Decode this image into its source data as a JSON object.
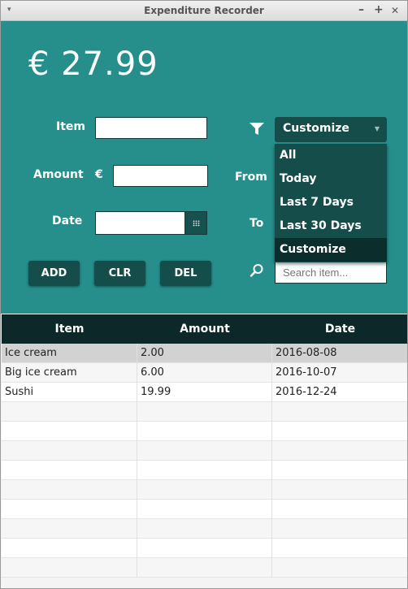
{
  "window": {
    "title": "Expenditure Recorder",
    "menu_glyph": "▾",
    "controls": {
      "minimize": "–",
      "maximize": "+",
      "close": "✕"
    }
  },
  "total": "€ 27.99",
  "form": {
    "item_label": "Item",
    "item_value": "",
    "amount_label": "Amount",
    "currency": "€",
    "amount_value": "",
    "date_label": "Date",
    "date_value": ""
  },
  "buttons": {
    "add": "ADD",
    "clear": "CLR",
    "delete": "DEL"
  },
  "filter": {
    "icon": "filter-icon",
    "selected": "Customize",
    "options": [
      "All",
      "Today",
      "Last 7 Days",
      "Last 30 Days",
      "Customize"
    ],
    "from_label": "From",
    "to_label": "To"
  },
  "search": {
    "icon": "search-icon",
    "placeholder": "Search item..."
  },
  "table": {
    "columns": [
      "Item",
      "Amount",
      "Date"
    ],
    "rows": [
      [
        "Ice cream",
        "2.00",
        "2016-08-08"
      ],
      [
        "Big ice cream",
        "6.00",
        "2016-10-07"
      ],
      [
        "Sushi",
        "19.99",
        "2016-12-24"
      ]
    ]
  },
  "colors": {
    "panel": "#268f8c",
    "button": "#154d4b",
    "header": "#0c2828",
    "selected_option": "#0b2d2c"
  }
}
